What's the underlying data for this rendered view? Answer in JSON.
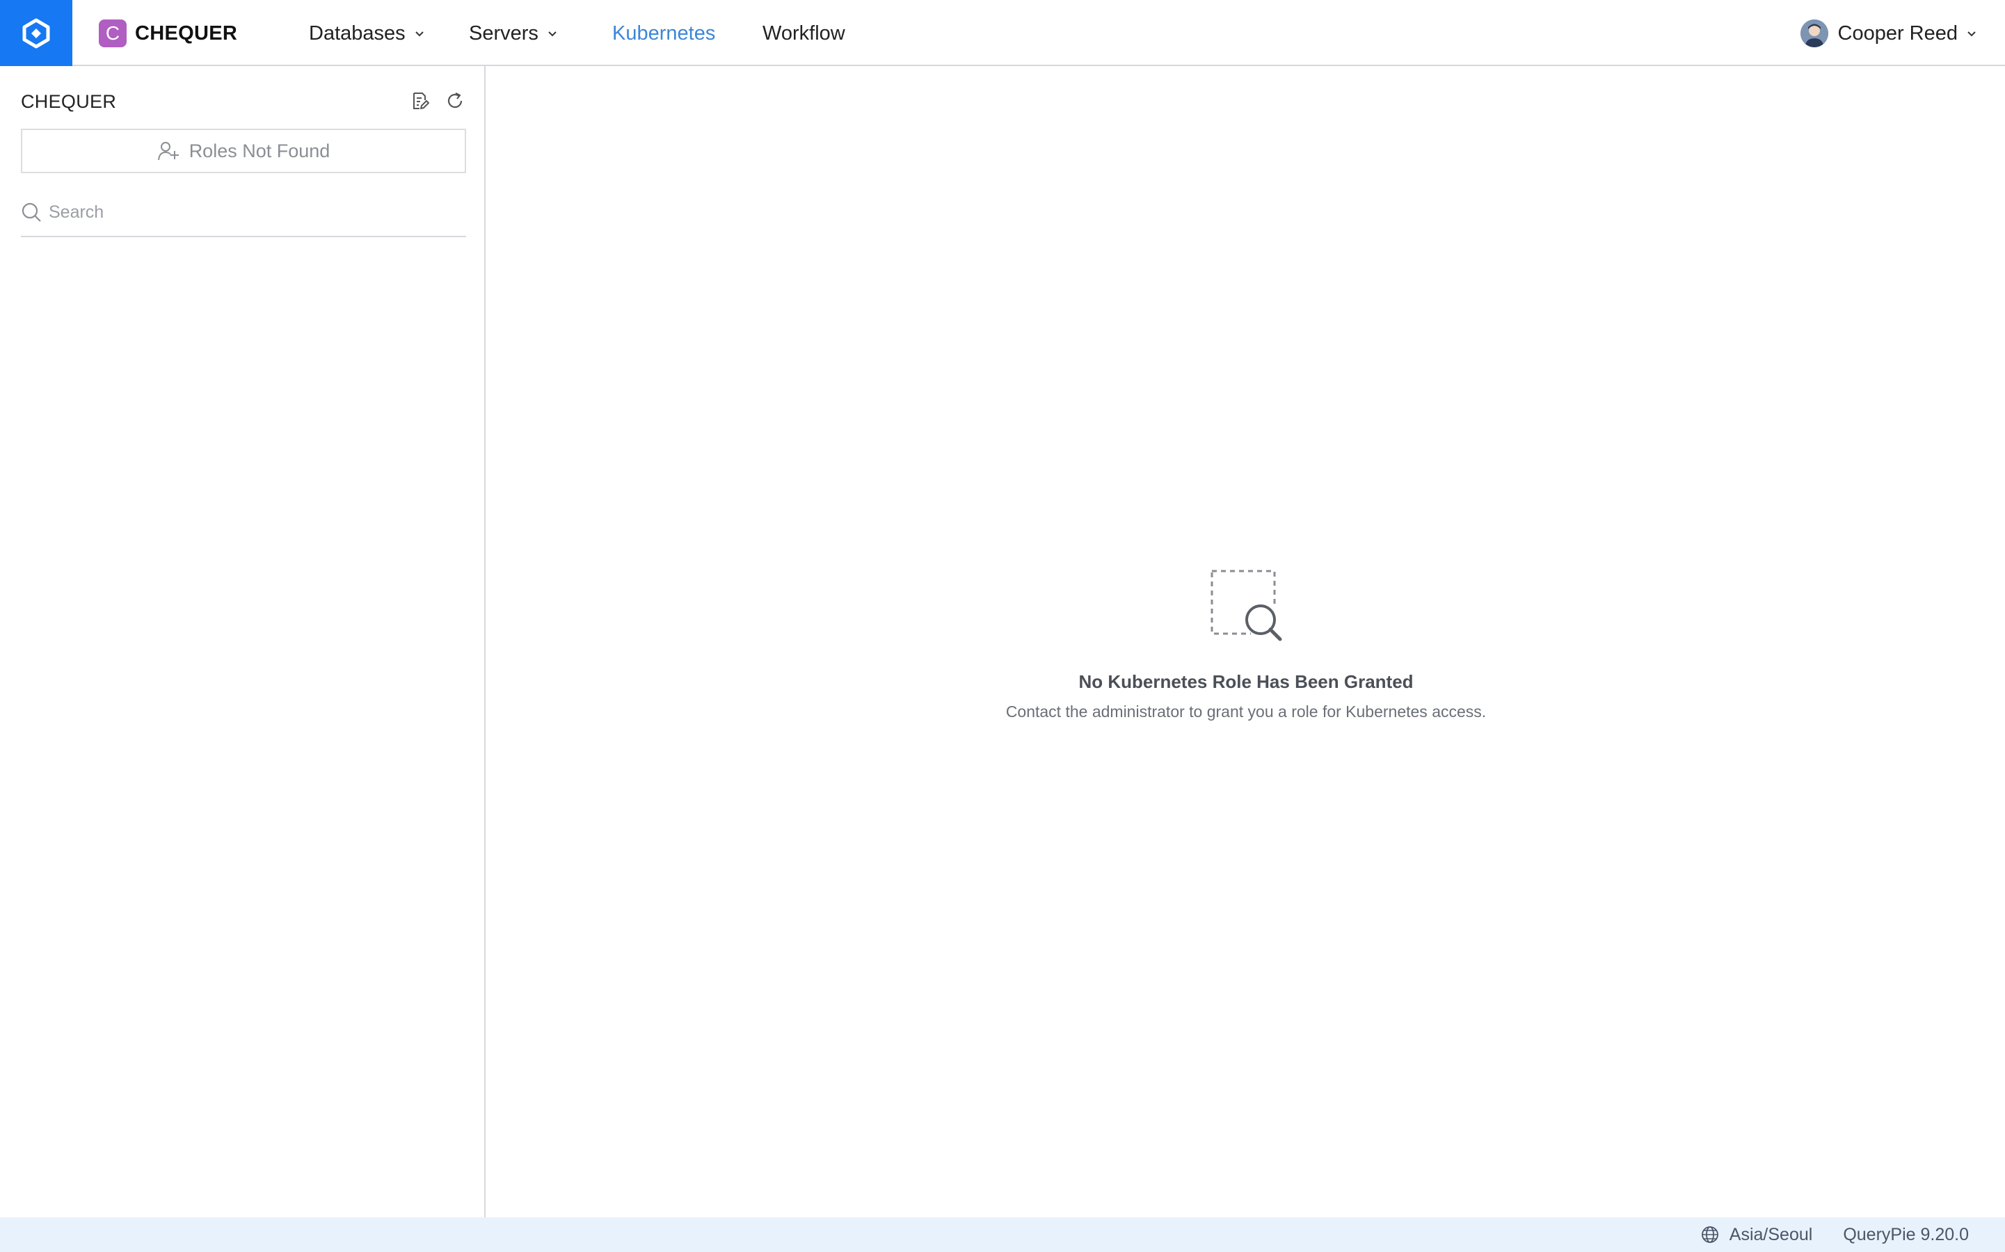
{
  "org": {
    "badge_letter": "C",
    "name": "CHEQUER",
    "badge_color": "#b05ec2"
  },
  "brand": {
    "logo_icon": "querypie-logo-icon",
    "color": "#1678f2"
  },
  "nav": {
    "items": [
      {
        "label": "Databases",
        "has_dropdown": true,
        "active": false
      },
      {
        "label": "Servers",
        "has_dropdown": true,
        "active": false
      },
      {
        "label": "Kubernetes",
        "has_dropdown": false,
        "active": true
      },
      {
        "label": "Workflow",
        "has_dropdown": false,
        "active": false
      }
    ],
    "active_color": "#3d86d9"
  },
  "user": {
    "name": "Cooper Reed"
  },
  "sidebar": {
    "title": "CHEQUER",
    "roles_button_label": "Roles Not Found",
    "search_placeholder": "Search"
  },
  "empty_state": {
    "title": "No Kubernetes Role Has Been Granted",
    "description": "Contact the administrator to grant you a role for Kubernetes access."
  },
  "footer": {
    "timezone": "Asia/Seoul",
    "version": "QueryPie 9.20.0",
    "background": "#e8f2fc"
  }
}
